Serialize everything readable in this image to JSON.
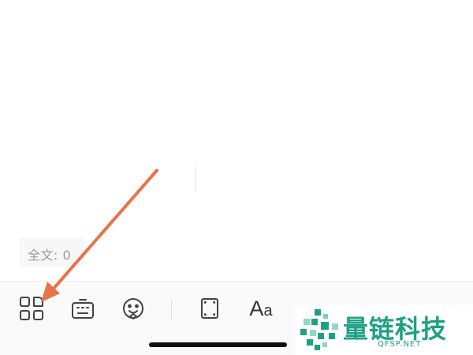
{
  "editor": {
    "word_count_label": "全文: 0"
  },
  "toolbar": {
    "buttons": [
      {
        "name": "insert-module",
        "icon": "grid-four-icon"
      },
      {
        "name": "keyboard",
        "icon": "keyboard-icon"
      },
      {
        "name": "emoji",
        "icon": "emoji-face-icon"
      },
      {
        "name": "fullscreen",
        "icon": "frame-expand-icon"
      },
      {
        "name": "text-format",
        "icon": "font-size-icon"
      }
    ],
    "font_button_big": "A",
    "font_button_small": "a"
  },
  "annotation": {
    "arrow_color": "#e8734a"
  },
  "watermark": {
    "name": "量链科技",
    "url": "QFSP.NET",
    "color": "#1fa085"
  }
}
